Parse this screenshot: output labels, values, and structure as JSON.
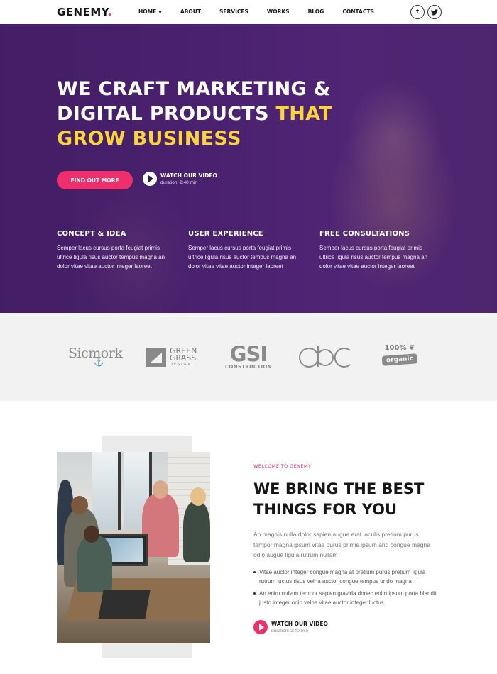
{
  "header": {
    "logo_text": "GENEMY",
    "logo_dot": ".",
    "nav": [
      "HOME",
      "ABOUT",
      "SERVICES",
      "WORKS",
      "BLOG",
      "CONTACTS"
    ],
    "socials": [
      {
        "icon": "facebook-icon",
        "glyph": "f"
      },
      {
        "icon": "twitter-icon",
        "glyph": "t"
      }
    ]
  },
  "hero": {
    "title_line1": "WE CRAFT MARKETING &",
    "title_line2_a": "DIGITAL PRODUCTS ",
    "title_line2_b": "THAT",
    "title_line3": "GROW BUSINESS",
    "cta_label": "FIND OUT MORE",
    "video_label": "WATCH OUR VIDEO",
    "video_duration": "duration: 2:40 min",
    "features": [
      {
        "title": "CONCEPT & IDEA",
        "text": "Semper lacus cursus porta feugiat primis ultrice ligula risus auctor tempus magna an dolor vitae vitae auctor integer laoreet"
      },
      {
        "title": "USER EXPERIENCE",
        "text": "Semper lacus cursus porta feugiat primis ultrice ligula risus auctor tempus magna an dolor vitae vitae auctor integer laoreet"
      },
      {
        "title": "FREE CONSULTATIONS",
        "text": "Semper lacus cursus porta feugiat primis ultrice ligula risus auctor tempus magna an dolor vitae vitae auctor integer laoreet"
      }
    ]
  },
  "logos": {
    "sicmork": "Sicmork",
    "green_grass_1": "GREEN",
    "green_grass_2": "GRASS",
    "green_grass_3": "DESIGN",
    "gsi_big": "GSI",
    "gsi_small": "CONSTRUCTION",
    "dbc": "dbc",
    "organic_pct": "100%",
    "organic": "organic"
  },
  "about": {
    "eyebrow": "WELCOME TO GENEMY",
    "title_line1": "WE BRING THE BEST",
    "title_line2": "THINGS FOR YOU",
    "text": "An magnis nulla dolor sapien augue erat iaculis pretium purus tempor magna ipsum vitae purus primis ipsum and congue magna odio augue ligula rutrum nullam",
    "list": [
      "Vitae auctor integer congue magna at pretium purus pretium ligula rutrum luctus risus velna auctor congue tempus undo magna",
      "An enim nullam tempor sapien gravida donec enim ipsum porta blandit justo integer odio velna vitae auctor integer luctus"
    ],
    "video_label": "WATCH OUR VIDEO",
    "video_duration": "duration: 2:40 min"
  },
  "colors": {
    "accent": "#ee2f6c",
    "highlight": "#f9d43a",
    "hero_overlay": "#481e6e"
  }
}
